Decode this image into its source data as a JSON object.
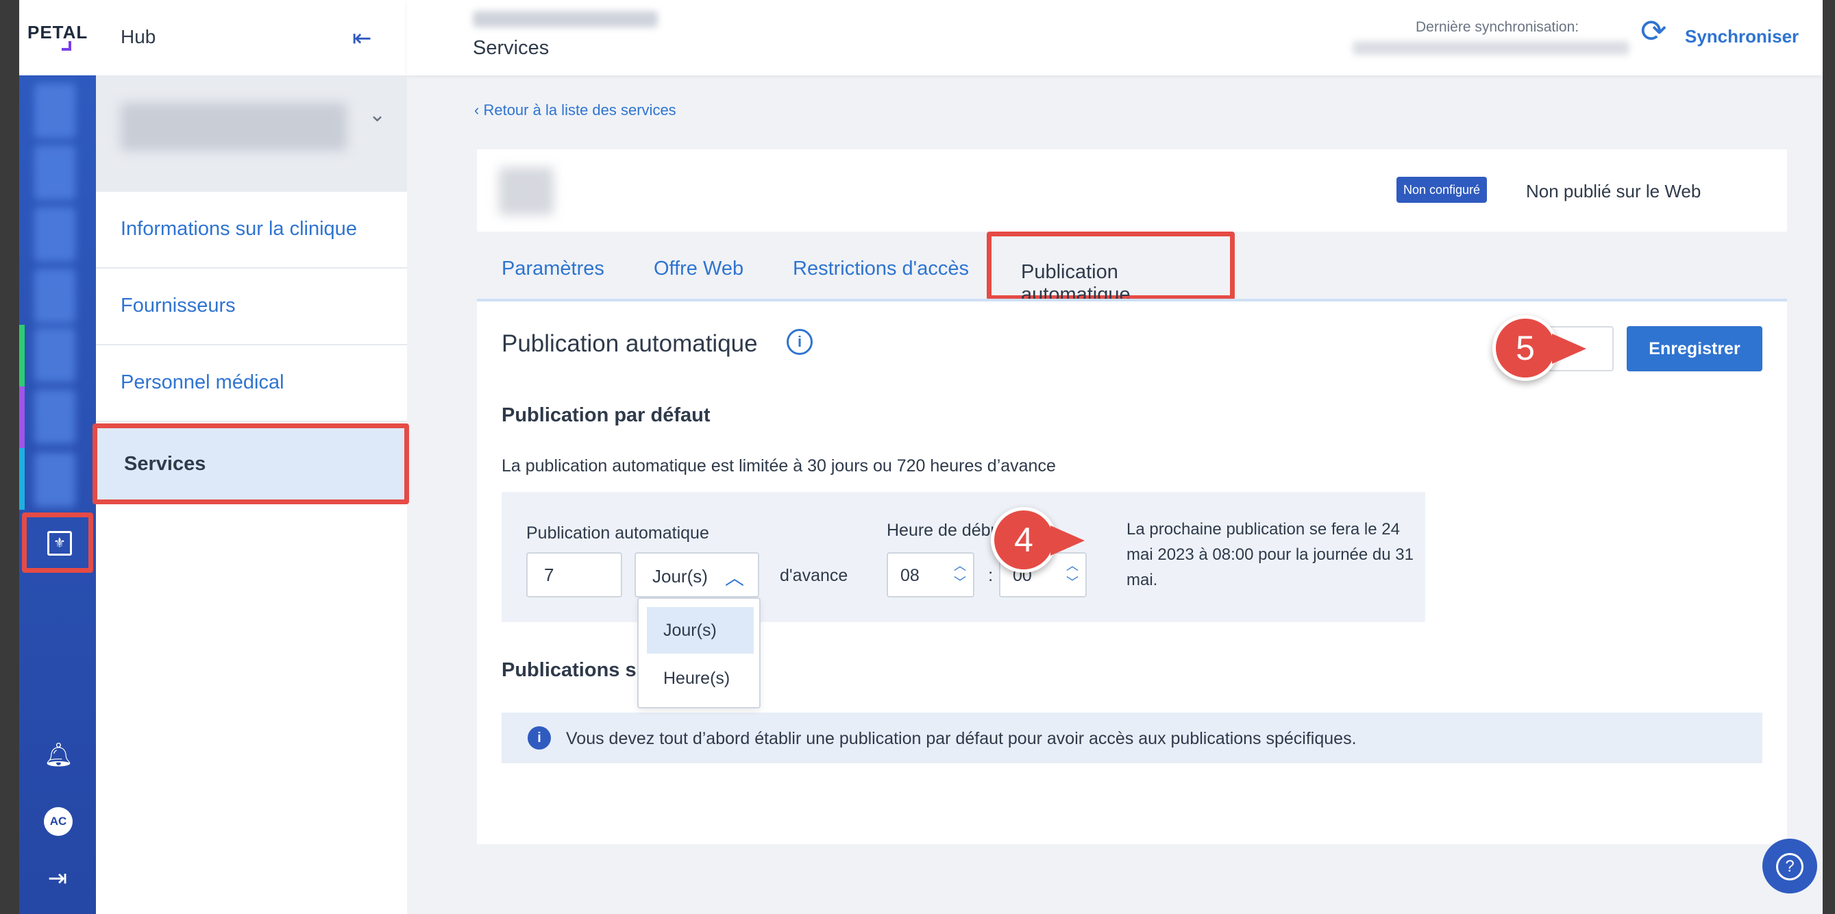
{
  "brand": {
    "logo": "PETAL",
    "app_title": "Hub"
  },
  "header": {
    "page_title": "Services",
    "sync_label": "Dernière synchronisation:",
    "sync_button": "Synchroniser"
  },
  "sidebar": {
    "items": [
      {
        "label": "Informations sur la clinique"
      },
      {
        "label": "Fournisseurs"
      },
      {
        "label": "Personnel médical"
      },
      {
        "label": "Services"
      }
    ]
  },
  "rail": {
    "avatar_initials": "AC"
  },
  "main": {
    "back_link": "Retour à la liste des services",
    "badge": "Non configuré",
    "web_status": "Non publié sur le Web",
    "tabs": [
      {
        "label": "Paramètres"
      },
      {
        "label": "Offre Web"
      },
      {
        "label": "Restrictions d'accès"
      },
      {
        "label": "Publication automatique"
      }
    ],
    "section_title": "Publication automatique",
    "save_button": "Enregistrer",
    "default_title": "Publication par défaut",
    "limit_text": "La publication automatique est limitée à 30 jours ou 720 heures d’avance",
    "auto_label": "Publication automatique",
    "auto_value": "7",
    "unit_value": "Jour(s)",
    "unit_options": [
      "Jour(s)",
      "Heure(s)"
    ],
    "advance_text": "d'avance",
    "start_label": "Heure de début d",
    "start_hour": "08",
    "start_minute": "00",
    "next_pub_text": "La prochaine publication se fera le 24 mai 2023 à 08:00 pour la journée du 31 mai.",
    "specific_title": "Publications sp",
    "notice_text": "Vous devez tout d’abord établir une publication par défaut pour avoir accès aux publications spécifiques."
  },
  "callouts": {
    "step4": "4",
    "step5": "5"
  },
  "colors": {
    "accent": "#2f74d0",
    "brand": "#2f5bc0",
    "highlight": "#e54b45"
  }
}
